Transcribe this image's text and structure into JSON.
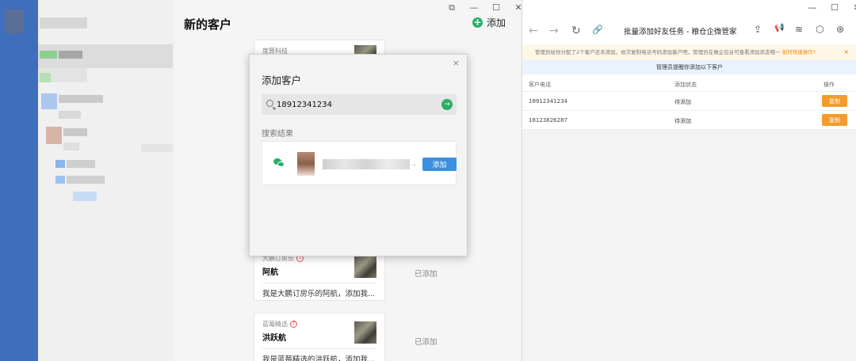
{
  "middle_window": {
    "title": "新的客户",
    "add_label": "添加",
    "window_controls": [
      "⧉",
      "—",
      "☐",
      "✕"
    ],
    "requests": [
      {
        "source": "度算科技",
        "name": "",
        "message": "",
        "status": ""
      },
      {
        "source": "大鹏订房乐",
        "name": "阿航",
        "message": "我是大鹏订房乐的阿航，添加我...",
        "status": "已添加"
      },
      {
        "source": "蓝莓精选",
        "name": "洪跃航",
        "message": "我是蓝莓精选的洪跃航，添加我...",
        "status": "已添加"
      }
    ]
  },
  "modal": {
    "title": "添加客户",
    "close": "×",
    "search_value": "18912341234",
    "go_icon": "→",
    "results_label": "搜索结果",
    "result": {
      "dot": ".",
      "add_button": "添加"
    }
  },
  "right_window": {
    "title": "批量添加好友任务 - 粮仓企微管家",
    "window_controls": [
      "—",
      "☐",
      "✕"
    ],
    "nav": [
      "←",
      "→",
      "↻",
      "🔗"
    ],
    "tools": [
      "⇪",
      "📢",
      "≋",
      "⬡",
      "⊛"
    ],
    "notice_text": "管理员给你分配了2个客户还未添加，依次复制电话号码添加客户吧，管理员在做企后台可查看添加状态哦～",
    "notice_link": "如何快速操作?",
    "notice_close": "×",
    "remind_text": "管理员提醒你添加以下客户",
    "table": {
      "headers": {
        "phone": "客户电话",
        "status": "添加状态",
        "action": "操作"
      },
      "rows": [
        {
          "phone": "18912341234",
          "status": "待添加",
          "action": "复制"
        },
        {
          "phone": "18123826287",
          "status": "待添加",
          "action": "复制"
        }
      ]
    }
  },
  "colors": {
    "wechat_green": "#2aae67",
    "primary_blue": "#3d8fe0",
    "copy_orange": "#f39b2c",
    "sidebar_blue": "#3f6ebb"
  }
}
